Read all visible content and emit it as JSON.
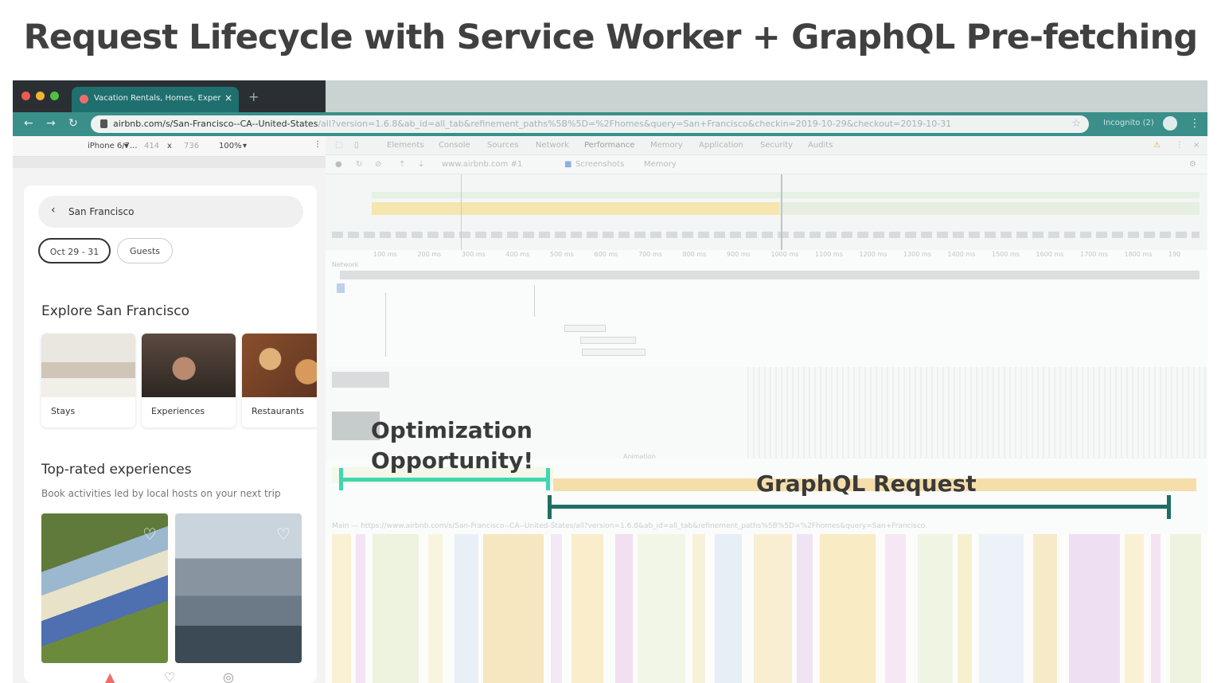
{
  "slide": {
    "title": "Request Lifecycle with Service Worker + GraphQL Pre-fetching"
  },
  "browser": {
    "tab_title": "Vacation Rentals, Homes, Exper",
    "url_host": "airbnb.com/s/San-Francisco--CA--United-States",
    "url_rest": "/all?version=1.6.8&ab_id=all_tab&refinement_paths%5B%5D=%2Fhomes&query=San+Francisco&checkin=2019-10-29&checkout=2019-10-31",
    "incognito_label": "Incognito (2)"
  },
  "device_toolbar": {
    "device": "iPhone 6/7...",
    "width": "414",
    "x": "x",
    "height": "736",
    "zoom": "100%"
  },
  "phone": {
    "search_location": "San Francisco",
    "dates_chip": "Oct 29 - 31",
    "guests_chip": "Guests",
    "explore_heading": "Explore San Francisco",
    "categories": [
      {
        "label": "Stays"
      },
      {
        "label": "Experiences"
      },
      {
        "label": "Restaurants"
      }
    ],
    "experiences_heading": "Top-rated experiences",
    "experiences_sub": "Book activities led by local hosts on your next trip"
  },
  "devtools": {
    "tabs": [
      "Elements",
      "Console",
      "Sources",
      "Network",
      "Performance",
      "Memory",
      "Application",
      "Security",
      "Audits"
    ],
    "toolbar": {
      "target": "www.airbnb.com #1",
      "screenshots_label": "Screenshots",
      "memory_label": "Memory"
    },
    "ruler_ticks": [
      "100 ms",
      "200 ms",
      "300 ms",
      "400 ms",
      "500 ms",
      "600 ms",
      "700 ms",
      "800 ms",
      "900 ms",
      "1000 ms",
      "1100 ms",
      "1200 ms",
      "1300 ms",
      "1400 ms",
      "1500 ms",
      "1600 ms",
      "1700 ms",
      "1800 ms",
      "190"
    ],
    "network_label": "Network",
    "main_label": "Main — https://www.airbnb.com/s/San-Francisco--CA--United-States/all?version=1.6.8&ab_id=all_tab&refinement_paths%5B%5D=%2Fhomes&query=San+Francisco",
    "animation_label": "Animation"
  },
  "annotations": {
    "optimization": "Optimization Opportunity!",
    "graphql": "GraphQL Request"
  },
  "colors": {
    "title": "#404040",
    "bracket_light": "#3fd6b0",
    "bracket_dark": "#1f6e63",
    "graphql_band": "#f6deaa",
    "tab_active": "#1f6f6f",
    "address_bar": "#3a8f8a"
  }
}
